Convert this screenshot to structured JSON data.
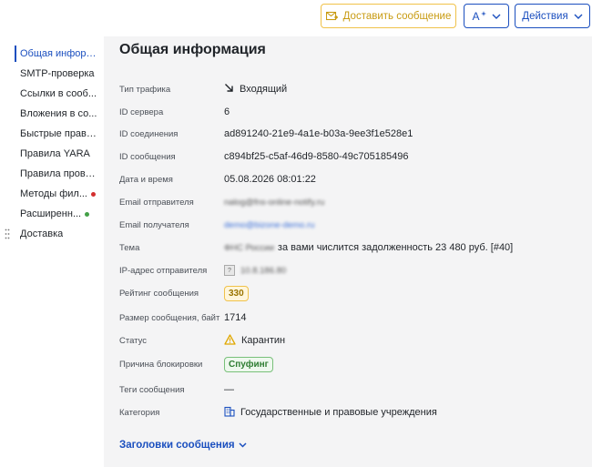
{
  "toolbar": {
    "deliver_label": "Доставить сообщение",
    "ai_label": "A",
    "actions_label": "Действия"
  },
  "sidebar": {
    "items": [
      {
        "label": "Общая информ...",
        "active": true,
        "dot": null
      },
      {
        "label": "SMTP-проверка",
        "active": false,
        "dot": null
      },
      {
        "label": "Ссылки в сооб...",
        "active": false,
        "dot": null
      },
      {
        "label": "Вложения в со...",
        "active": false,
        "dot": null
      },
      {
        "label": "Быстрые прави...",
        "active": false,
        "dot": null
      },
      {
        "label": "Правила YARA",
        "active": false,
        "dot": null
      },
      {
        "label": "Правила прове...",
        "active": false,
        "dot": null
      },
      {
        "label": "Методы фил...",
        "active": false,
        "dot": "#d32f2f"
      },
      {
        "label": "Расширенн...",
        "active": false,
        "dot": "#43a047"
      },
      {
        "label": "Доставка",
        "active": false,
        "dot": null
      }
    ]
  },
  "main": {
    "title": "Общая информация",
    "fields": {
      "traffic_type": {
        "label": "Тип трафика",
        "value": "Входящий"
      },
      "server_id": {
        "label": "ID сервера",
        "value": "6"
      },
      "connection_id": {
        "label": "ID соединения",
        "value": "ad891240-21e9-4a1e-b03a-9ee3f1e528e1"
      },
      "message_id": {
        "label": "ID сообщения",
        "value": "c894bf25-c5af-46d9-8580-49c705185496"
      },
      "datetime": {
        "label": "Дата и время",
        "value": "05.08.2026 08:01:22"
      },
      "sender_email": {
        "label": "Email отправителя",
        "value": "nalog@fns-online-notify.ru"
      },
      "recipient_email": {
        "label": "Email получателя",
        "value": "demo@bizone-demo.ru"
      },
      "subject": {
        "label": "Тема",
        "prefix": "ФНС России",
        "value": "за вами числится задолженность 23 480 руб. [#40]"
      },
      "sender_ip": {
        "label": "IP-адрес отправителя",
        "value": "10.8.186.80",
        "flag": "?"
      },
      "rating": {
        "label": "Рейтинг сообщения",
        "value": "330"
      },
      "size": {
        "label": "Размер сообщения, байт",
        "value": "1714"
      },
      "status": {
        "label": "Статус",
        "value": "Карантин"
      },
      "block_reason": {
        "label": "Причина блокировки",
        "value": "Спуфинг"
      },
      "tags": {
        "label": "Теги сообщения",
        "value": "—"
      },
      "category": {
        "label": "Категория",
        "value": "Государственные и правовые учреждения"
      }
    },
    "headers_link": "Заголовки сообщения"
  },
  "colors": {
    "accent": "#1b4fbf",
    "warning": "#f0c24a",
    "success": "#2e7d32",
    "danger": "#d32f2f"
  }
}
